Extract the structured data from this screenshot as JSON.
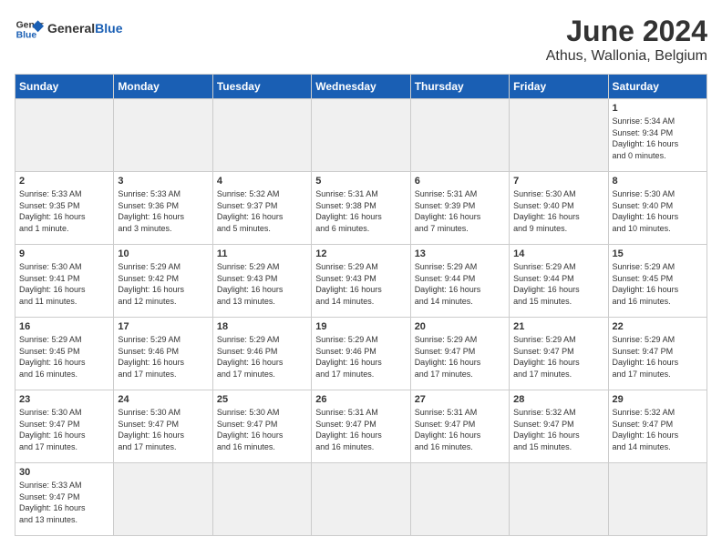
{
  "logo": {
    "text_general": "General",
    "text_blue": "Blue"
  },
  "header": {
    "title": "June 2024",
    "subtitle": "Athus, Wallonia, Belgium"
  },
  "days_of_week": [
    "Sunday",
    "Monday",
    "Tuesday",
    "Wednesday",
    "Thursday",
    "Friday",
    "Saturday"
  ],
  "weeks": [
    [
      {
        "day": "",
        "info": "",
        "empty": true
      },
      {
        "day": "",
        "info": "",
        "empty": true
      },
      {
        "day": "",
        "info": "",
        "empty": true
      },
      {
        "day": "",
        "info": "",
        "empty": true
      },
      {
        "day": "",
        "info": "",
        "empty": true
      },
      {
        "day": "",
        "info": "",
        "empty": true
      },
      {
        "day": "1",
        "info": "Sunrise: 5:34 AM\nSunset: 9:34 PM\nDaylight: 16 hours\nand 0 minutes."
      }
    ],
    [
      {
        "day": "2",
        "info": "Sunrise: 5:33 AM\nSunset: 9:35 PM\nDaylight: 16 hours\nand 1 minute."
      },
      {
        "day": "3",
        "info": "Sunrise: 5:33 AM\nSunset: 9:36 PM\nDaylight: 16 hours\nand 3 minutes."
      },
      {
        "day": "4",
        "info": "Sunrise: 5:32 AM\nSunset: 9:37 PM\nDaylight: 16 hours\nand 5 minutes."
      },
      {
        "day": "5",
        "info": "Sunrise: 5:31 AM\nSunset: 9:38 PM\nDaylight: 16 hours\nand 6 minutes."
      },
      {
        "day": "6",
        "info": "Sunrise: 5:31 AM\nSunset: 9:39 PM\nDaylight: 16 hours\nand 7 minutes."
      },
      {
        "day": "7",
        "info": "Sunrise: 5:30 AM\nSunset: 9:40 PM\nDaylight: 16 hours\nand 9 minutes."
      },
      {
        "day": "8",
        "info": "Sunrise: 5:30 AM\nSunset: 9:40 PM\nDaylight: 16 hours\nand 10 minutes."
      }
    ],
    [
      {
        "day": "9",
        "info": "Sunrise: 5:30 AM\nSunset: 9:41 PM\nDaylight: 16 hours\nand 11 minutes."
      },
      {
        "day": "10",
        "info": "Sunrise: 5:29 AM\nSunset: 9:42 PM\nDaylight: 16 hours\nand 12 minutes."
      },
      {
        "day": "11",
        "info": "Sunrise: 5:29 AM\nSunset: 9:43 PM\nDaylight: 16 hours\nand 13 minutes."
      },
      {
        "day": "12",
        "info": "Sunrise: 5:29 AM\nSunset: 9:43 PM\nDaylight: 16 hours\nand 14 minutes."
      },
      {
        "day": "13",
        "info": "Sunrise: 5:29 AM\nSunset: 9:44 PM\nDaylight: 16 hours\nand 14 minutes."
      },
      {
        "day": "14",
        "info": "Sunrise: 5:29 AM\nSunset: 9:44 PM\nDaylight: 16 hours\nand 15 minutes."
      },
      {
        "day": "15",
        "info": "Sunrise: 5:29 AM\nSunset: 9:45 PM\nDaylight: 16 hours\nand 16 minutes."
      }
    ],
    [
      {
        "day": "16",
        "info": "Sunrise: 5:29 AM\nSunset: 9:45 PM\nDaylight: 16 hours\nand 16 minutes."
      },
      {
        "day": "17",
        "info": "Sunrise: 5:29 AM\nSunset: 9:46 PM\nDaylight: 16 hours\nand 17 minutes."
      },
      {
        "day": "18",
        "info": "Sunrise: 5:29 AM\nSunset: 9:46 PM\nDaylight: 16 hours\nand 17 minutes."
      },
      {
        "day": "19",
        "info": "Sunrise: 5:29 AM\nSunset: 9:46 PM\nDaylight: 16 hours\nand 17 minutes."
      },
      {
        "day": "20",
        "info": "Sunrise: 5:29 AM\nSunset: 9:47 PM\nDaylight: 16 hours\nand 17 minutes."
      },
      {
        "day": "21",
        "info": "Sunrise: 5:29 AM\nSunset: 9:47 PM\nDaylight: 16 hours\nand 17 minutes."
      },
      {
        "day": "22",
        "info": "Sunrise: 5:29 AM\nSunset: 9:47 PM\nDaylight: 16 hours\nand 17 minutes."
      }
    ],
    [
      {
        "day": "23",
        "info": "Sunrise: 5:30 AM\nSunset: 9:47 PM\nDaylight: 16 hours\nand 17 minutes."
      },
      {
        "day": "24",
        "info": "Sunrise: 5:30 AM\nSunset: 9:47 PM\nDaylight: 16 hours\nand 17 minutes."
      },
      {
        "day": "25",
        "info": "Sunrise: 5:30 AM\nSunset: 9:47 PM\nDaylight: 16 hours\nand 16 minutes."
      },
      {
        "day": "26",
        "info": "Sunrise: 5:31 AM\nSunset: 9:47 PM\nDaylight: 16 hours\nand 16 minutes."
      },
      {
        "day": "27",
        "info": "Sunrise: 5:31 AM\nSunset: 9:47 PM\nDaylight: 16 hours\nand 16 minutes."
      },
      {
        "day": "28",
        "info": "Sunrise: 5:32 AM\nSunset: 9:47 PM\nDaylight: 16 hours\nand 15 minutes."
      },
      {
        "day": "29",
        "info": "Sunrise: 5:32 AM\nSunset: 9:47 PM\nDaylight: 16 hours\nand 14 minutes."
      }
    ],
    [
      {
        "day": "30",
        "info": "Sunrise: 5:33 AM\nSunset: 9:47 PM\nDaylight: 16 hours\nand 13 minutes."
      },
      {
        "day": "",
        "info": "",
        "empty": true
      },
      {
        "day": "",
        "info": "",
        "empty": true
      },
      {
        "day": "",
        "info": "",
        "empty": true
      },
      {
        "day": "",
        "info": "",
        "empty": true
      },
      {
        "day": "",
        "info": "",
        "empty": true
      },
      {
        "day": "",
        "info": "",
        "empty": true
      }
    ]
  ]
}
